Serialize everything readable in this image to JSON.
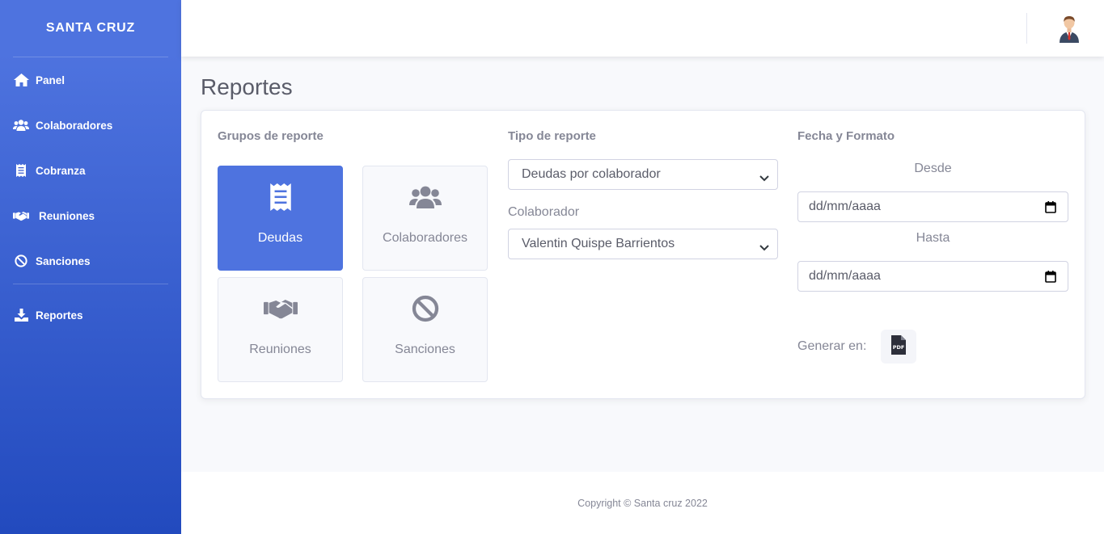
{
  "brand": "SANTA CRUZ",
  "sidebar": {
    "items": [
      {
        "label": "Panel",
        "icon": "home-icon"
      },
      {
        "label": "Colaboradores",
        "icon": "users-icon"
      },
      {
        "label": "Cobranza",
        "icon": "receipt-icon"
      },
      {
        "label": "Reuniones",
        "icon": "handshake-icon"
      },
      {
        "label": "Sanciones",
        "icon": "ban-icon"
      },
      {
        "label": "Reportes",
        "icon": "download-icon"
      }
    ]
  },
  "page": {
    "title": "Reportes"
  },
  "groups": {
    "heading": "Grupos de reporte",
    "buttons": [
      {
        "label": "Deudas",
        "icon": "receipt-icon",
        "active": true
      },
      {
        "label": "Colaboradores",
        "icon": "users-icon",
        "active": false
      },
      {
        "label": "Reuniones",
        "icon": "handshake-icon",
        "active": false
      },
      {
        "label": "Sanciones",
        "icon": "ban-icon",
        "active": false
      }
    ]
  },
  "tipo": {
    "heading": "Tipo de reporte",
    "report_type_value": "Deudas por colaborador",
    "colaborador_label": "Colaborador",
    "colaborador_value": "Valentin Quispe Barrientos"
  },
  "fecha": {
    "heading": "Fecha y Formato",
    "desde_label": "Desde",
    "desde_placeholder": "dd/mm/aaaa",
    "hasta_label": "Hasta",
    "hasta_placeholder": "dd/mm/aaaa",
    "generar_label": "Generar en:",
    "pdf_icon": "pdf-file-icon"
  },
  "footer": {
    "copyright": "Copyright © Santa cruz 2022"
  },
  "colors": {
    "primary": "#4e73df",
    "sidebar_end": "#224abe",
    "text_muted": "#858796"
  }
}
